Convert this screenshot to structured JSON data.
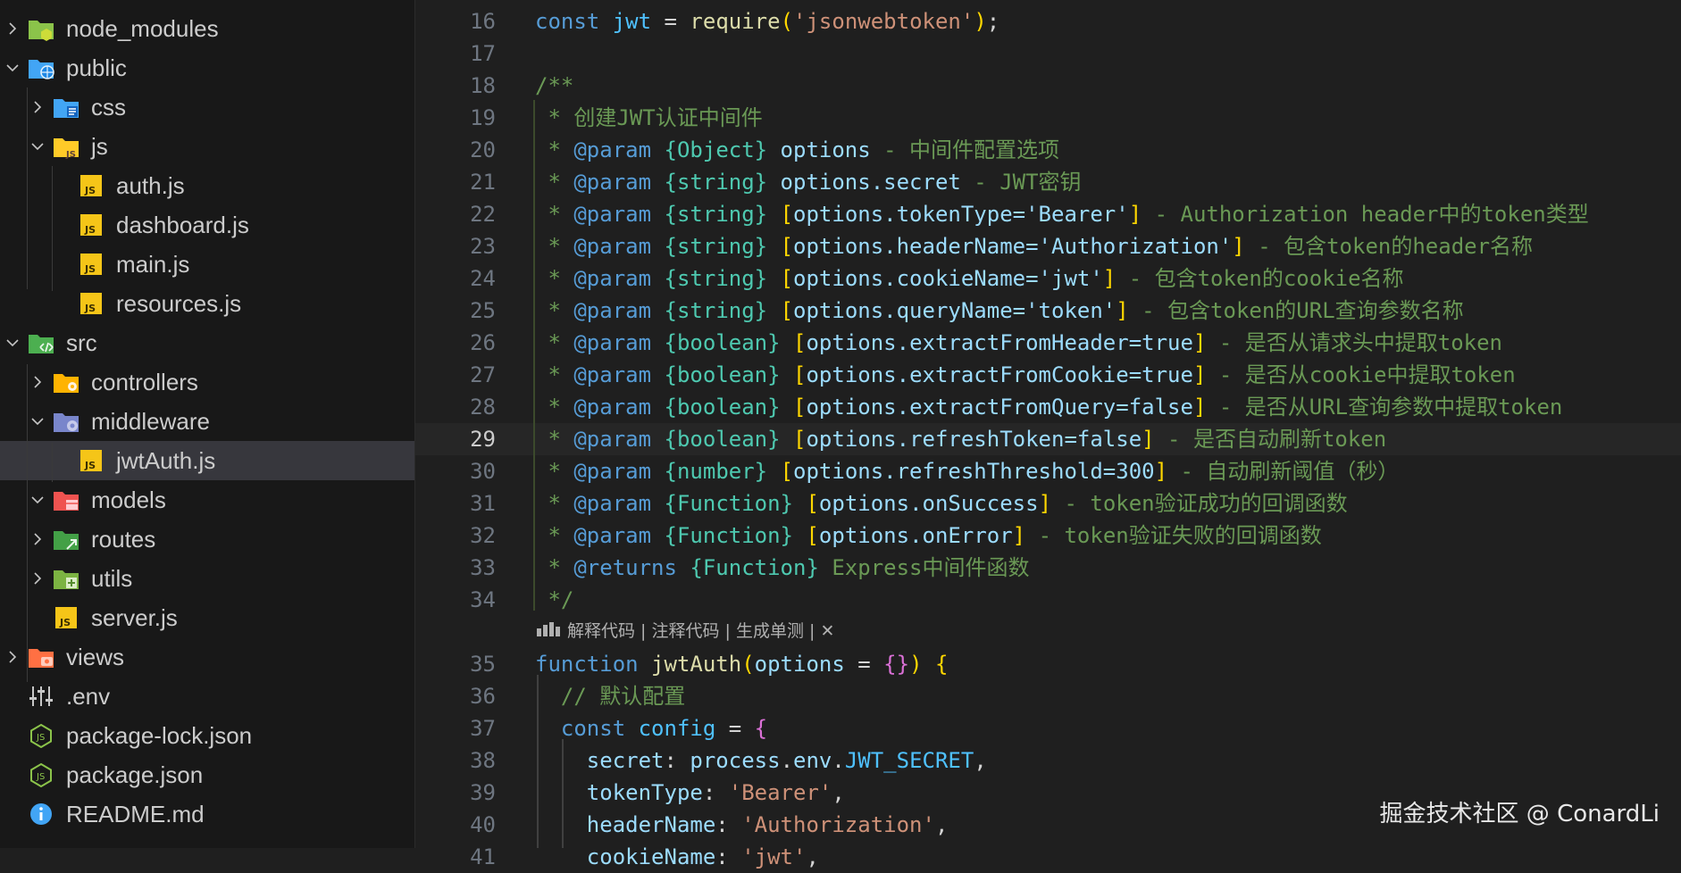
{
  "explorer": {
    "items": [
      {
        "label": "node_modules",
        "icon": "folder-node-icon",
        "chevron": "right",
        "depth": 0
      },
      {
        "label": "public",
        "icon": "folder-public-icon",
        "chevron": "down",
        "depth": 0
      },
      {
        "label": "css",
        "icon": "folder-css-icon",
        "chevron": "right",
        "depth": 1
      },
      {
        "label": "js",
        "icon": "folder-js-icon",
        "chevron": "down",
        "depth": 1
      },
      {
        "label": "auth.js",
        "icon": "js-file-icon",
        "chevron": "",
        "depth": 2
      },
      {
        "label": "dashboard.js",
        "icon": "js-file-icon",
        "chevron": "",
        "depth": 2
      },
      {
        "label": "main.js",
        "icon": "js-file-icon",
        "chevron": "",
        "depth": 2
      },
      {
        "label": "resources.js",
        "icon": "js-file-icon",
        "chevron": "",
        "depth": 2
      },
      {
        "label": "src",
        "icon": "folder-src-icon",
        "chevron": "down",
        "depth": 0
      },
      {
        "label": "controllers",
        "icon": "folder-controllers-icon",
        "chevron": "right",
        "depth": 1
      },
      {
        "label": "middleware",
        "icon": "folder-middleware-icon",
        "chevron": "down",
        "depth": 1
      },
      {
        "label": "jwtAuth.js",
        "icon": "js-file-icon",
        "chevron": "",
        "depth": 2,
        "active": true
      },
      {
        "label": "models",
        "icon": "folder-models-icon",
        "chevron": "down",
        "depth": 1
      },
      {
        "label": "routes",
        "icon": "folder-routes-icon",
        "chevron": "right",
        "depth": 1
      },
      {
        "label": "utils",
        "icon": "folder-utils-icon",
        "chevron": "right",
        "depth": 1
      },
      {
        "label": "server.js",
        "icon": "js-file-icon",
        "chevron": "",
        "depth": 1
      },
      {
        "label": "views",
        "icon": "folder-views-icon",
        "chevron": "right",
        "depth": 0
      },
      {
        "label": ".env",
        "icon": "env-settings-icon",
        "chevron": "",
        "depth": 0
      },
      {
        "label": "package-lock.json",
        "icon": "nodejs-icon",
        "chevron": "",
        "depth": 0
      },
      {
        "label": "package.json",
        "icon": "nodejs-icon",
        "chevron": "",
        "depth": 0
      },
      {
        "label": "README.md",
        "icon": "info-icon",
        "chevron": "",
        "depth": 0
      }
    ]
  },
  "editor": {
    "current_line": "29",
    "lines": [
      {
        "n": "16",
        "t": [
          [
            "kw",
            "const "
          ],
          [
            "var",
            "jwt"
          ],
          [
            "op",
            " = "
          ],
          [
            "fn",
            "require"
          ],
          [
            "br1",
            "("
          ],
          [
            "str",
            "'jsonwebtoken'"
          ],
          [
            "br1",
            ")"
          ],
          [
            "op",
            ";"
          ]
        ]
      },
      {
        "n": "17",
        "t": []
      },
      {
        "n": "18",
        "t": [
          [
            "cm",
            "/**"
          ]
        ]
      },
      {
        "n": "19",
        "t": [
          [
            "cm",
            " * 创建JWT认证中间件"
          ]
        ]
      },
      {
        "n": "20",
        "t": [
          [
            "cm",
            " * "
          ],
          [
            "tag",
            "@param"
          ],
          [
            "cm",
            " "
          ],
          [
            "typ",
            "{Object}"
          ],
          [
            "lvar",
            " options"
          ],
          [
            "cm",
            " - 中间件配置选项"
          ]
        ]
      },
      {
        "n": "21",
        "t": [
          [
            "cm",
            " * "
          ],
          [
            "tag",
            "@param"
          ],
          [
            "cm",
            " "
          ],
          [
            "typ",
            "{string}"
          ],
          [
            "lvar",
            " options.secret"
          ],
          [
            "cm",
            " - JWT密钥"
          ]
        ]
      },
      {
        "n": "22",
        "t": [
          [
            "cm",
            " * "
          ],
          [
            "tag",
            "@param"
          ],
          [
            "cm",
            " "
          ],
          [
            "typ",
            "{string}"
          ],
          [
            "cm",
            " "
          ],
          [
            "br1",
            "["
          ],
          [
            "lvar",
            "options.tokenType='Bearer'"
          ],
          [
            "br1",
            "]"
          ],
          [
            "cm",
            " - Authorization header中的token类型"
          ]
        ]
      },
      {
        "n": "23",
        "t": [
          [
            "cm",
            " * "
          ],
          [
            "tag",
            "@param"
          ],
          [
            "cm",
            " "
          ],
          [
            "typ",
            "{string}"
          ],
          [
            "cm",
            " "
          ],
          [
            "br1",
            "["
          ],
          [
            "lvar",
            "options.headerName='Authorization'"
          ],
          [
            "br1",
            "]"
          ],
          [
            "cm",
            " - 包含token的header名称"
          ]
        ]
      },
      {
        "n": "24",
        "t": [
          [
            "cm",
            " * "
          ],
          [
            "tag",
            "@param"
          ],
          [
            "cm",
            " "
          ],
          [
            "typ",
            "{string}"
          ],
          [
            "cm",
            " "
          ],
          [
            "br1",
            "["
          ],
          [
            "lvar",
            "options.cookieName='jwt'"
          ],
          [
            "br1",
            "]"
          ],
          [
            "cm",
            " - 包含token的cookie名称"
          ]
        ]
      },
      {
        "n": "25",
        "t": [
          [
            "cm",
            " * "
          ],
          [
            "tag",
            "@param"
          ],
          [
            "cm",
            " "
          ],
          [
            "typ",
            "{string}"
          ],
          [
            "cm",
            " "
          ],
          [
            "br1",
            "["
          ],
          [
            "lvar",
            "options.queryName='token'"
          ],
          [
            "br1",
            "]"
          ],
          [
            "cm",
            " - 包含token的URL查询参数名称"
          ]
        ]
      },
      {
        "n": "26",
        "t": [
          [
            "cm",
            " * "
          ],
          [
            "tag",
            "@param"
          ],
          [
            "cm",
            " "
          ],
          [
            "typ",
            "{boolean}"
          ],
          [
            "cm",
            " "
          ],
          [
            "br1",
            "["
          ],
          [
            "lvar",
            "options.extractFromHeader=true"
          ],
          [
            "br1",
            "]"
          ],
          [
            "cm",
            " - 是否从请求头中提取token"
          ]
        ]
      },
      {
        "n": "27",
        "t": [
          [
            "cm",
            " * "
          ],
          [
            "tag",
            "@param"
          ],
          [
            "cm",
            " "
          ],
          [
            "typ",
            "{boolean}"
          ],
          [
            "cm",
            " "
          ],
          [
            "br1",
            "["
          ],
          [
            "lvar",
            "options.extractFromCookie=true"
          ],
          [
            "br1",
            "]"
          ],
          [
            "cm",
            " - 是否从cookie中提取token"
          ]
        ]
      },
      {
        "n": "28",
        "t": [
          [
            "cm",
            " * "
          ],
          [
            "tag",
            "@param"
          ],
          [
            "cm",
            " "
          ],
          [
            "typ",
            "{boolean}"
          ],
          [
            "cm",
            " "
          ],
          [
            "br1",
            "["
          ],
          [
            "lvar",
            "options.extractFromQuery=false"
          ],
          [
            "br1",
            "]"
          ],
          [
            "cm",
            " - 是否从URL查询参数中提取token"
          ]
        ]
      },
      {
        "n": "29",
        "t": [
          [
            "cm",
            " * "
          ],
          [
            "tag",
            "@param"
          ],
          [
            "cm",
            " "
          ],
          [
            "typ",
            "{boolean}"
          ],
          [
            "cm",
            " "
          ],
          [
            "br1",
            "["
          ],
          [
            "lvar",
            "options.refreshToken=false"
          ],
          [
            "br1",
            "]"
          ],
          [
            "cm",
            " - 是否自动刷新token"
          ]
        ]
      },
      {
        "n": "30",
        "t": [
          [
            "cm",
            " * "
          ],
          [
            "tag",
            "@param"
          ],
          [
            "cm",
            " "
          ],
          [
            "typ",
            "{number}"
          ],
          [
            "cm",
            " "
          ],
          [
            "br1",
            "["
          ],
          [
            "lvar",
            "options.refreshThreshold=300"
          ],
          [
            "br1",
            "]"
          ],
          [
            "cm",
            " - 自动刷新阈值（秒）"
          ]
        ]
      },
      {
        "n": "31",
        "t": [
          [
            "cm",
            " * "
          ],
          [
            "tag",
            "@param"
          ],
          [
            "cm",
            " "
          ],
          [
            "typ",
            "{Function}"
          ],
          [
            "cm",
            " "
          ],
          [
            "br1",
            "["
          ],
          [
            "lvar",
            "options.onSuccess"
          ],
          [
            "br1",
            "]"
          ],
          [
            "cm",
            " - token验证成功的回调函数"
          ]
        ]
      },
      {
        "n": "32",
        "t": [
          [
            "cm",
            " * "
          ],
          [
            "tag",
            "@param"
          ],
          [
            "cm",
            " "
          ],
          [
            "typ",
            "{Function}"
          ],
          [
            "cm",
            " "
          ],
          [
            "br1",
            "["
          ],
          [
            "lvar",
            "options.onError"
          ],
          [
            "br1",
            "]"
          ],
          [
            "cm",
            " - token验证失败的回调函数"
          ]
        ]
      },
      {
        "n": "33",
        "t": [
          [
            "cm",
            " * "
          ],
          [
            "tag",
            "@returns"
          ],
          [
            "cm",
            " "
          ],
          [
            "typ",
            "{Function}"
          ],
          [
            "cm",
            " Express中间件函数"
          ]
        ]
      },
      {
        "n": "34",
        "t": [
          [
            "cm",
            " */"
          ]
        ]
      },
      {
        "n": "35",
        "t": [
          [
            "kw",
            "function "
          ],
          [
            "fn",
            "jwtAuth"
          ],
          [
            "br1",
            "("
          ],
          [
            "lvar",
            "options"
          ],
          [
            "op",
            " = "
          ],
          [
            "br2",
            "{}"
          ],
          [
            "br1",
            ")"
          ],
          [
            "op",
            " "
          ],
          [
            "br1",
            "{"
          ]
        ]
      },
      {
        "n": "36",
        "t": [
          [
            "cm",
            "  // 默认配置"
          ]
        ]
      },
      {
        "n": "37",
        "t": [
          [
            "kw",
            "  const "
          ],
          [
            "var",
            "config"
          ],
          [
            "op",
            " = "
          ],
          [
            "br2",
            "{"
          ]
        ]
      },
      {
        "n": "38",
        "t": [
          [
            "lvar",
            "    secret"
          ],
          [
            "op",
            ": "
          ],
          [
            "lvar",
            "process"
          ],
          [
            "op",
            "."
          ],
          [
            "lvar",
            "env"
          ],
          [
            "op",
            "."
          ],
          [
            "cn",
            "JWT_SECRET"
          ],
          [
            "op",
            ","
          ]
        ]
      },
      {
        "n": "39",
        "t": [
          [
            "lvar",
            "    tokenType"
          ],
          [
            "op",
            ": "
          ],
          [
            "str",
            "'Bearer'"
          ],
          [
            "op",
            ","
          ]
        ]
      },
      {
        "n": "40",
        "t": [
          [
            "lvar",
            "    headerName"
          ],
          [
            "op",
            ": "
          ],
          [
            "str",
            "'Authorization'"
          ],
          [
            "op",
            ","
          ]
        ]
      },
      {
        "n": "41",
        "t": [
          [
            "lvar",
            "    cookieName"
          ],
          [
            "op",
            ": "
          ],
          [
            "str",
            "'jwt'"
          ],
          [
            "op",
            ","
          ]
        ]
      }
    ],
    "codelens": {
      "items": [
        "解释代码",
        "注释代码",
        "生成单测"
      ],
      "separator": " | ",
      "close": "✕"
    }
  },
  "watermark": "掘金技术社区 @ ConardLi",
  "colors": {
    "keyword": "#569cd6",
    "function": "#dcdcaa",
    "string": "#ce9178",
    "comment": "#6a9955",
    "type": "#4ec9b0",
    "variable": "#9cdcfe",
    "bracket_gold": "#ffd700",
    "bracket_pink": "#da70d6",
    "sidebar_bg": "#181818",
    "editor_bg": "#1f1f1f",
    "active_row": "#37373d"
  }
}
